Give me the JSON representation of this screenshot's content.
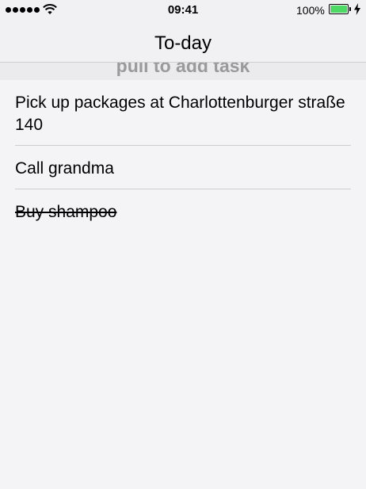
{
  "status_bar": {
    "time": "09:41",
    "battery_percent": "100%",
    "battery_level": 1.0,
    "signal_bars": 5,
    "icons": [
      "signal-icon",
      "wifi-icon",
      "battery-icon",
      "charging-icon"
    ],
    "battery_color": "#4cd964"
  },
  "nav": {
    "title": "To-day"
  },
  "pull_hint": {
    "text": "pull to add task"
  },
  "tasks": [
    {
      "text": "Pick up packages at Charlottenburger straße 140",
      "completed": false
    },
    {
      "text": "Call grandma",
      "completed": false
    },
    {
      "text": "Buy shampoo",
      "completed": true
    }
  ]
}
